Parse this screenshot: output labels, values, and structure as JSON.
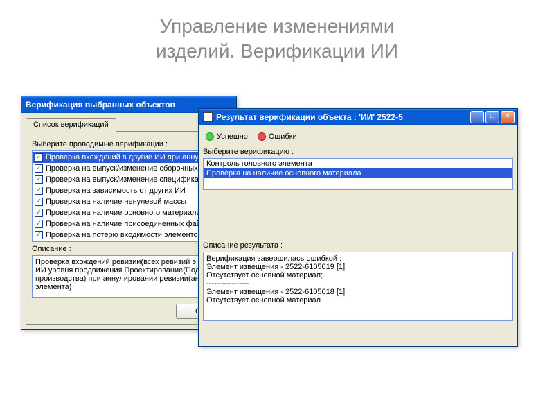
{
  "slide": {
    "title_line1": "Управление изменениями",
    "title_line2": "изделий. Верификации ИИ"
  },
  "win1": {
    "title": "Верификация выбранных объектов",
    "tab": "Список верификаций",
    "prompt": "Выберите проводимые верификации :",
    "items": [
      "Проверка вхождений в другие ИИ при анну",
      "Проверка на выпуск/изменение сборочных",
      "Проверка на выпуск/изменение специфика",
      "Проверка на зависимость от других ИИ",
      "Проверка на наличие ненулевой массы",
      "Проверка на наличие основного материала",
      "Проверка на наличие присоединенных фай",
      "Проверка на потерю входимости элементо"
    ],
    "desc_label": "Описание :",
    "desc_text": "Проверка вхождений ревизии(всех ревизий э\nИИ уровня продвижения Проектирование(Под\nпроизводства) при аннулировании ревизии(ан\nэлемента)",
    "ok": "OK"
  },
  "win2": {
    "title": "Результат верификации объекта : 'ИИ' 2522-5",
    "tab_ok": "Успешно",
    "tab_err": "Ошибки",
    "select_label": "Выберите верификацию :",
    "verifs": [
      "Контроль головного элемента",
      "Проверка на наличие основного материала"
    ],
    "selected_index": 1,
    "result_label": "Описание результата :",
    "result_text": "Верификация завершилась ошибкой :\nЭлемент извещения - 2522-6105019 [1]\nОтсутствует основной материал;\n-----------------\nЭлемент извещения - 2522-6105018 [1]\nОтсутствует основной материал"
  }
}
